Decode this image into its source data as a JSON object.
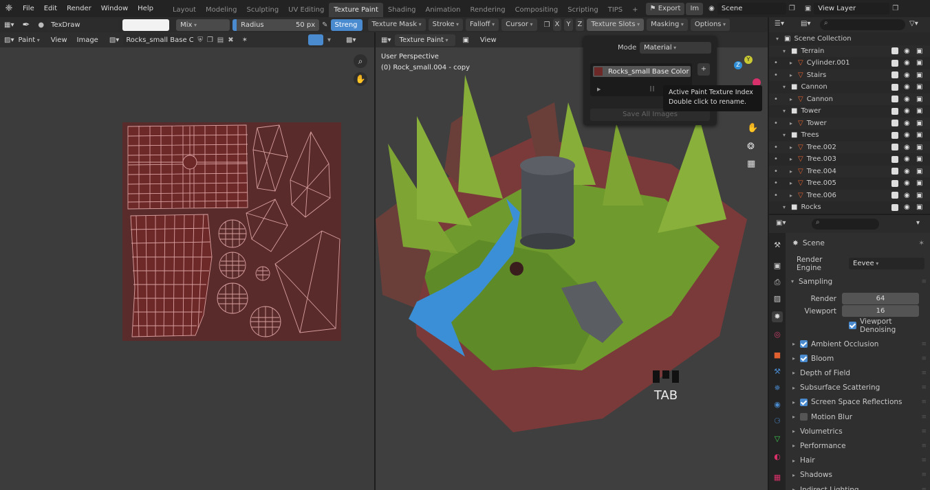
{
  "menus": [
    "File",
    "Edit",
    "Render",
    "Window",
    "Help"
  ],
  "workspace_tabs": [
    {
      "label": "Layout",
      "active": false
    },
    {
      "label": "Modeling",
      "active": false
    },
    {
      "label": "Sculpting",
      "active": false
    },
    {
      "label": "UV Editing",
      "active": false
    },
    {
      "label": "Texture Paint",
      "active": true
    },
    {
      "label": "Shading",
      "active": false
    },
    {
      "label": "Animation",
      "active": false
    },
    {
      "label": "Rendering",
      "active": false
    },
    {
      "label": "Compositing",
      "active": false
    },
    {
      "label": "Scripting",
      "active": false
    },
    {
      "label": "TIPS",
      "active": false
    }
  ],
  "topbar": {
    "add_tab": "+",
    "export_label": "Export",
    "import_label": "Im",
    "scene_name": "Scene",
    "view_layer": "View Layer"
  },
  "tool_header": {
    "brush_name": "TexDraw",
    "blend_mode": "Mix",
    "radius_label": "Radius",
    "radius_value": "50 px",
    "strength_label": "Streng",
    "texture_mask": "Texture Mask",
    "stroke": "Stroke",
    "falloff": "Falloff",
    "cursor": "Cursor",
    "axis_x": "X",
    "axis_y": "Y",
    "axis_z": "Z",
    "texture_slots": "Texture Slots",
    "masking": "Masking",
    "options": "Options"
  },
  "uv_header": {
    "mode": "Paint",
    "view": "View",
    "image": "Image",
    "image_name": "Rocks_small Base C..."
  },
  "viewport_header": {
    "mode": "Texture Paint",
    "view": "View"
  },
  "viewport": {
    "perspective": "User Perspective",
    "object": "(0) Rock_small.004 - copy",
    "key_hint": "TAB"
  },
  "popover": {
    "mode_label": "Mode",
    "mode_value": "Material",
    "slot_name": "Rocks_small Base Color",
    "add_label": "+",
    "save_all": "Save All Images"
  },
  "tooltip": {
    "title": "Active Paint Texture Index",
    "body": "Double click to rename."
  },
  "outliner": {
    "rows": [
      {
        "label": "Scene Collection",
        "type": "scene",
        "indent": 0
      },
      {
        "label": "Terrain",
        "type": "collection",
        "indent": 1
      },
      {
        "label": "Cylinder.001",
        "type": "object",
        "indent": 2
      },
      {
        "label": "Stairs",
        "type": "object",
        "indent": 2
      },
      {
        "label": "Cannon",
        "type": "collection",
        "indent": 1
      },
      {
        "label": "Cannon",
        "type": "object",
        "indent": 2
      },
      {
        "label": "Tower",
        "type": "collection",
        "indent": 1
      },
      {
        "label": "Tower",
        "type": "object",
        "indent": 2
      },
      {
        "label": "Trees",
        "type": "collection",
        "indent": 1
      },
      {
        "label": "Tree.002",
        "type": "object",
        "indent": 2
      },
      {
        "label": "Tree.003",
        "type": "object",
        "indent": 2
      },
      {
        "label": "Tree.004",
        "type": "object",
        "indent": 2
      },
      {
        "label": "Tree.005",
        "type": "object",
        "indent": 2
      },
      {
        "label": "Tree.006",
        "type": "object",
        "indent": 2
      },
      {
        "label": "Rocks",
        "type": "collection",
        "indent": 1
      }
    ]
  },
  "properties": {
    "context": "Scene",
    "render_engine_label": "Render Engine",
    "render_engine": "Eevee",
    "sampling": "Sampling",
    "render_label": "Render",
    "render_samples": "64",
    "viewport_label": "Viewport",
    "viewport_samples": "16",
    "viewport_denoising": "Viewport Denoising",
    "panels": [
      {
        "label": "Ambient Occlusion",
        "checkbox": "on"
      },
      {
        "label": "Bloom",
        "checkbox": "on"
      },
      {
        "label": "Depth of Field",
        "checkbox": "none"
      },
      {
        "label": "Subsurface Scattering",
        "checkbox": "none"
      },
      {
        "label": "Screen Space Reflections",
        "checkbox": "on"
      },
      {
        "label": "Motion Blur",
        "checkbox": "off"
      },
      {
        "label": "Volumetrics",
        "checkbox": "none"
      },
      {
        "label": "Performance",
        "checkbox": "none"
      },
      {
        "label": "Hair",
        "checkbox": "none"
      },
      {
        "label": "Shadows",
        "checkbox": "none"
      },
      {
        "label": "Indirect Lighting",
        "checkbox": "none"
      }
    ]
  },
  "colors": {
    "accent": "#4a8bcf",
    "active_tab": "#3d3d3d",
    "texture": "#5a2b2b",
    "wire": "#d9a0a0",
    "grass": "#6f9a2e",
    "water": "#3b8fd6"
  }
}
